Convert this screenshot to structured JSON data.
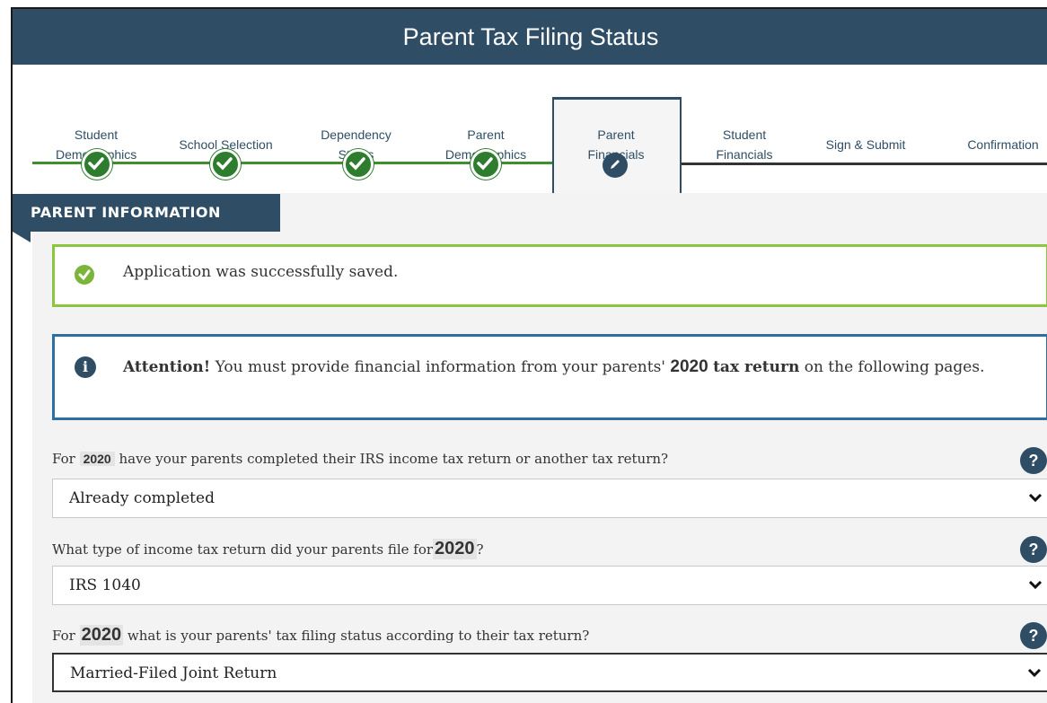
{
  "header": {
    "title": "Parent Tax Filing Status"
  },
  "steps": [
    {
      "label": "Student\nDemographics",
      "state": "complete"
    },
    {
      "label": "School Selection",
      "state": "complete"
    },
    {
      "label": "Dependency\nStatus",
      "state": "complete"
    },
    {
      "label": "Parent\nDemographics",
      "state": "complete"
    },
    {
      "label": "Parent\nFinancials",
      "state": "active"
    },
    {
      "label": "Student\nFinancials",
      "state": "pending"
    },
    {
      "label": "Sign & Submit",
      "state": "pending"
    },
    {
      "label": "Confirmation",
      "state": "pending"
    }
  ],
  "section": {
    "title": "PARENT INFORMATION"
  },
  "alerts": {
    "success": "Application was successfully saved.",
    "attention_label": "Attention!",
    "attention_text_1": "You must provide financial information from your parents'",
    "attention_year": "2020",
    "attention_bold": "tax return",
    "attention_text_2": "on the following pages."
  },
  "questions": [
    {
      "prefix": "For",
      "year": "2020",
      "suffix": "have your parents completed their IRS income tax return or another tax return?",
      "value": "Already completed"
    },
    {
      "prefix": "What type of income tax return did your parents file for",
      "year": "2020",
      "suffix": "?",
      "value": "IRS 1040"
    },
    {
      "prefix": "For",
      "year": "2020",
      "suffix": "what is your parents' tax filing status according to their tax return?",
      "value": "Married-Filed Joint Return"
    }
  ],
  "colors": {
    "header": "#2f4e66",
    "success_border": "#8cc63f",
    "attention_border": "#2c6fa3",
    "progress_line": "#3f8f2b"
  },
  "icons": {
    "complete": "check-icon",
    "active": "pencil-icon",
    "success": "check-circle-icon",
    "attention": "info-icon",
    "help": "question-icon",
    "select": "chevron-down-icon"
  }
}
